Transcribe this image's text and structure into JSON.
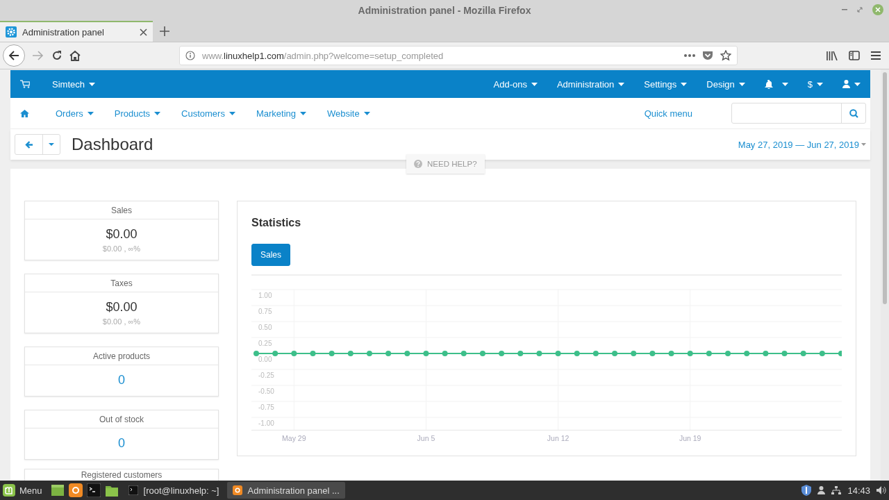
{
  "window": {
    "title": "Administration panel - Mozilla Firefox"
  },
  "browser": {
    "tabs": [
      {
        "label": "Administration panel",
        "selected": true
      }
    ],
    "url_parts": [
      "www.",
      "linuxhelp1.com",
      "/admin.php?welcome=setup_completed"
    ]
  },
  "admin": {
    "store": "Simtech",
    "top_menu": [
      "Add-ons",
      "Administration",
      "Settings",
      "Design"
    ],
    "currency": "$",
    "nav": [
      "Orders",
      "Products",
      "Customers",
      "Marketing",
      "Website"
    ],
    "quick_menu": "Quick menu",
    "page_title": "Dashboard",
    "date_range": "May 27, 2019 — Jun 27, 2019",
    "help": "NEED HELP?",
    "stats": [
      {
        "label": "Sales",
        "value": "$0.00",
        "sub": "$0.00 , ∞%",
        "kind": "money"
      },
      {
        "label": "Taxes",
        "value": "$0.00",
        "sub": "$0.00 , ∞%",
        "kind": "money"
      },
      {
        "label": "Active products",
        "value": "0",
        "kind": "count"
      },
      {
        "label": "Out of stock",
        "value": "0",
        "kind": "count"
      },
      {
        "label": "Registered customers",
        "kind": "cut"
      }
    ],
    "statistics": {
      "title": "Statistics",
      "tabs": [
        {
          "label": "Sales",
          "selected": true
        }
      ],
      "chart_data": {
        "type": "line",
        "grid": true,
        "categories": [
          null,
          null,
          "May 29",
          null,
          null,
          null,
          null,
          null,
          null,
          "Jun 5",
          null,
          null,
          null,
          null,
          null,
          null,
          "Jun 12",
          null,
          null,
          null,
          null,
          null,
          null,
          "Jun 19",
          null,
          null,
          null,
          null,
          null,
          null,
          null,
          null
        ],
        "series": [
          {
            "color": "#3dbf8a",
            "marker": "circle",
            "values": [
              0,
              0,
              0,
              0,
              0,
              0,
              0,
              0,
              0,
              0,
              0,
              0,
              0,
              0,
              0,
              0,
              0,
              0,
              0,
              0,
              0,
              0,
              0,
              0,
              0,
              0,
              0,
              0,
              0,
              0,
              0,
              0
            ]
          }
        ],
        "ylim": [
          -1.2,
          1
        ],
        "yticks": [
          {
            "value": 1,
            "label": "1.00"
          },
          {
            "value": 0.75,
            "label": "0.75"
          },
          {
            "value": 0.5,
            "label": "0.50"
          },
          {
            "value": 0.25,
            "label": "0.25"
          },
          {
            "value": 0,
            "label": "0.00"
          },
          {
            "value": -0.25,
            "label": "-0.25"
          },
          {
            "value": -0.5,
            "label": "-0.50"
          },
          {
            "value": -0.75,
            "label": "-0.75"
          },
          {
            "value": -1,
            "label": "-1.00"
          }
        ]
      }
    }
  },
  "taskbar": {
    "menu": "Menu",
    "windows": [
      {
        "label": "[root@linuxhelp: ~]",
        "kind": "terminal",
        "selected": false
      },
      {
        "label": "Administration panel ...",
        "kind": "firefox",
        "selected": true
      }
    ],
    "clock": "14:43"
  }
}
